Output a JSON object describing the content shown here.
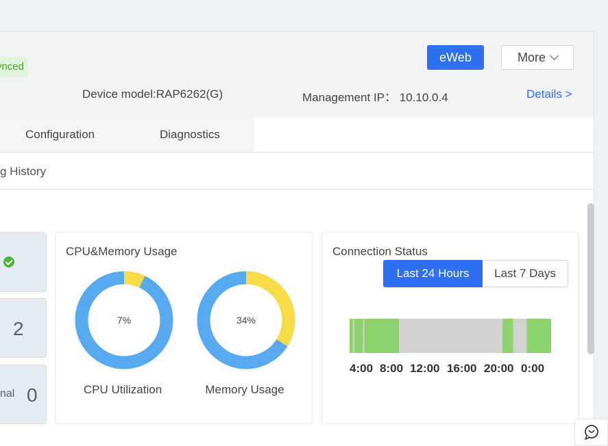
{
  "header": {
    "sync_badge": "ynced",
    "eweb_button": "eWeb",
    "more_button": "More",
    "device_model": "Device model:RAP6262(G)",
    "management_ip": "Management IP： 10.10.0.4",
    "details_link": "Details >"
  },
  "tabs": [
    "Configuration",
    "Diagnostics"
  ],
  "subtab": "g History",
  "stats": {
    "count_value": "2",
    "abnormal_label": "nal",
    "abnormal_value": "0"
  },
  "cpu_memory": {
    "title": "CPU&Memory Usage",
    "cpu_percent": 7,
    "cpu_text": "7%",
    "cpu_label": "CPU Utilization",
    "memory_percent": 34,
    "memory_text": "34%",
    "memory_label": "Memory Usage",
    "used_color": "#f7dc45",
    "free_color": "#58aaf0"
  },
  "connection": {
    "title": "Connection Status",
    "range_active": "Last 24 Hours",
    "range_other": "Last 7 Days",
    "online_color": "#8cd36e",
    "offline_color": "#d2d2d2",
    "time_labels": [
      "4:00",
      "8:00",
      "12:00",
      "16:00",
      "20:00",
      "0:00"
    ],
    "timeline_hours": [
      {
        "start": 0,
        "end": 0.4,
        "status": "online"
      },
      {
        "start": 0.4,
        "end": 0.55,
        "status": "offline"
      },
      {
        "start": 0.55,
        "end": 1.6,
        "status": "online"
      },
      {
        "start": 1.6,
        "end": 1.75,
        "status": "offline"
      },
      {
        "start": 1.75,
        "end": 5.9,
        "status": "online"
      },
      {
        "start": 5.9,
        "end": 18.2,
        "status": "offline"
      },
      {
        "start": 18.2,
        "end": 19.5,
        "status": "online"
      },
      {
        "start": 19.5,
        "end": 21.1,
        "status": "offline"
      },
      {
        "start": 21.1,
        "end": 24,
        "status": "online"
      }
    ]
  }
}
